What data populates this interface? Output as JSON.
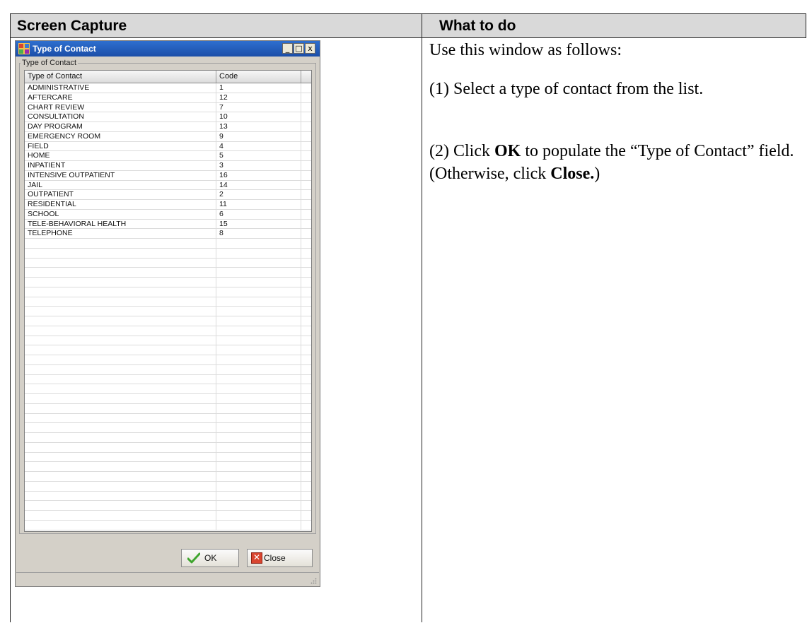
{
  "table_headers": {
    "left": "Screen Capture",
    "right": "What to do"
  },
  "dialog": {
    "title": "Type of Contact",
    "group_label": "Type of Contact",
    "window_buttons": {
      "minimize": "_",
      "maximize": "□",
      "close": "x"
    },
    "columns": [
      "Type of Contact",
      "Code"
    ],
    "rows": [
      {
        "type": "ADMINISTRATIVE",
        "code": "1"
      },
      {
        "type": "AFTERCARE",
        "code": "12"
      },
      {
        "type": "CHART REVIEW",
        "code": "7"
      },
      {
        "type": "CONSULTATION",
        "code": "10"
      },
      {
        "type": "DAY PROGRAM",
        "code": "13"
      },
      {
        "type": "EMERGENCY ROOM",
        "code": "9"
      },
      {
        "type": "FIELD",
        "code": "4"
      },
      {
        "type": "HOME",
        "code": "5"
      },
      {
        "type": "INPATIENT",
        "code": "3"
      },
      {
        "type": "INTENSIVE OUTPATIENT",
        "code": "16"
      },
      {
        "type": "JAIL",
        "code": "14"
      },
      {
        "type": "OUTPATIENT",
        "code": "2"
      },
      {
        "type": "RESIDENTIAL",
        "code": "11"
      },
      {
        "type": "SCHOOL",
        "code": "6"
      },
      {
        "type": "TELE-BEHAVIORAL HEALTH",
        "code": "15"
      },
      {
        "type": "TELEPHONE",
        "code": "8"
      }
    ],
    "buttons": {
      "ok": "OK",
      "close": "Close"
    },
    "icons": {
      "ok": "checkmark-icon",
      "close": "x-icon",
      "app": "app-icon",
      "grip": "resize-grip-icon"
    }
  },
  "instructions": {
    "intro": "Use this window as follows:",
    "step1": "(1) Select a type of contact from the list.",
    "step2_prefix": "(2) Click ",
    "step2_ok": "OK",
    "step2_middle": " to populate the “Type of Contact” field. (Otherwise, click ",
    "step2_close": "Close.",
    "step2_suffix": ")"
  }
}
